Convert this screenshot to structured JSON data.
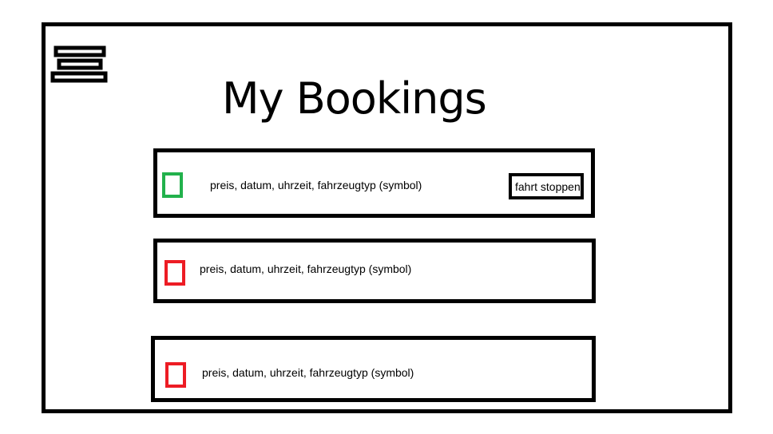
{
  "page": {
    "title": "My Bookings"
  },
  "colors": {
    "active": "#22b14c",
    "inactive": "#ed1c24",
    "border": "#000000"
  },
  "bookings": [
    {
      "summary": "preis, datum, uhrzeit, fahrzeugtyp (symbol)",
      "status": "active",
      "action_label": "fahrt stoppen"
    },
    {
      "summary": "preis, datum, uhrzeit, fahrzeugtyp (symbol)",
      "status": "inactive"
    },
    {
      "summary": "preis, datum, uhrzeit, fahrzeugtyp (symbol)",
      "status": "inactive"
    }
  ]
}
